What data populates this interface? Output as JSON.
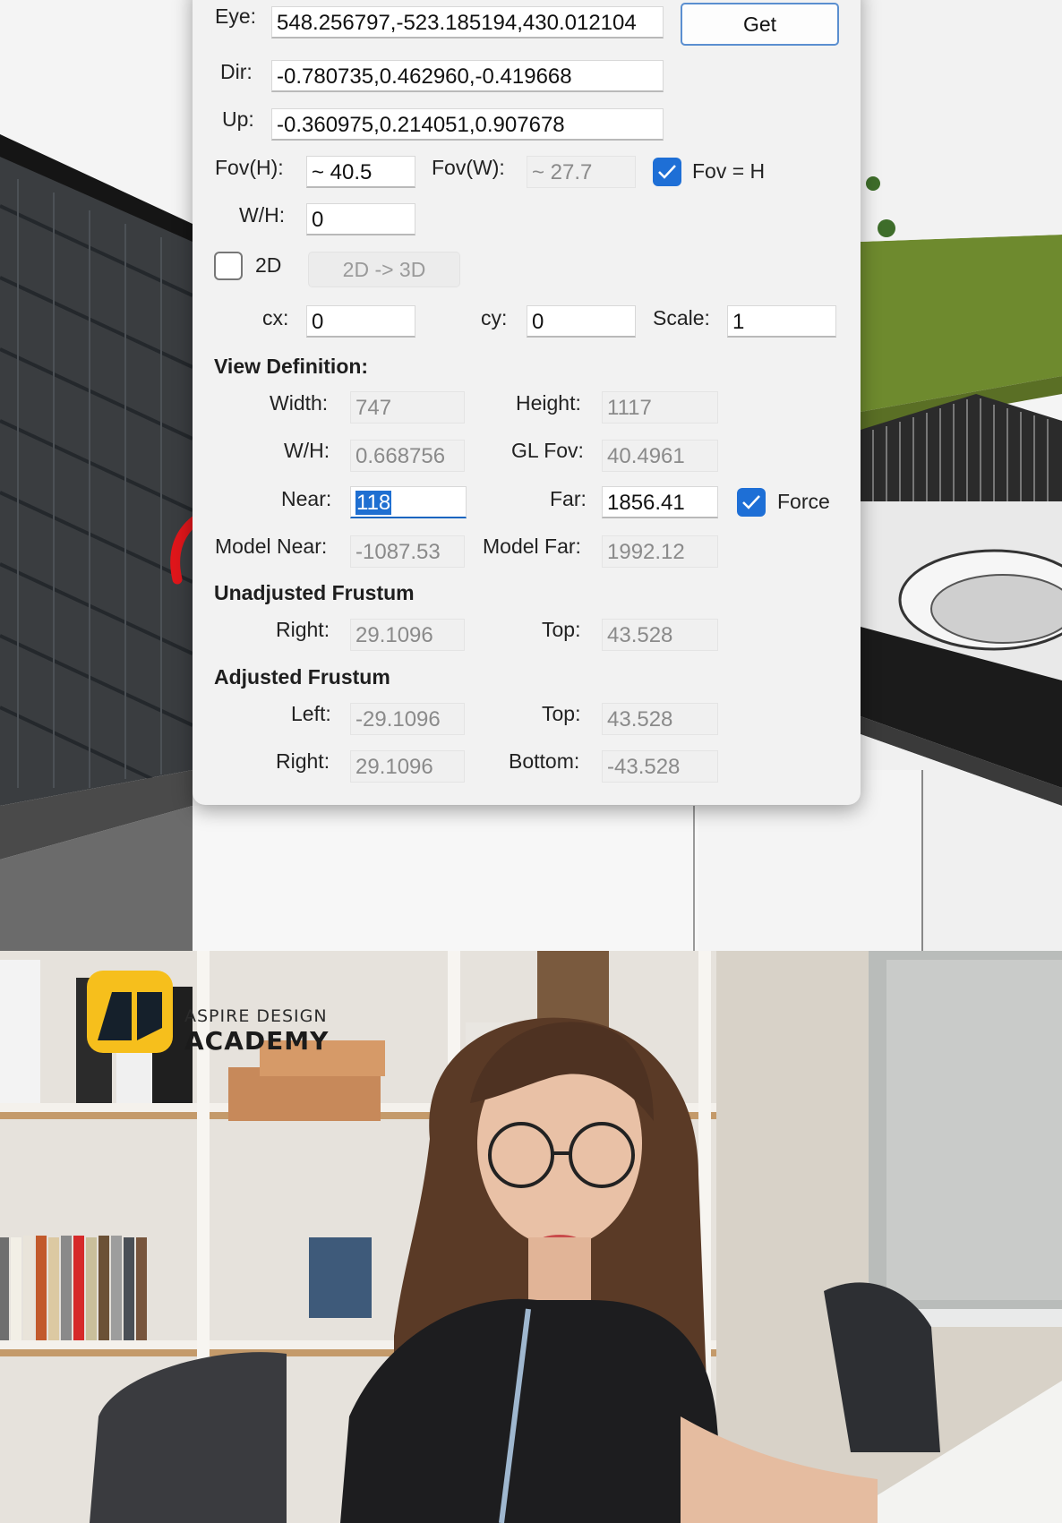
{
  "camera": {
    "eye_label": "Eye:",
    "eye_value": "548.256797,-523.185194,430.012104",
    "get_label": "Get",
    "dir_label": "Dir:",
    "dir_value": "-0.780735,0.462960,-0.419668",
    "up_label": "Up:",
    "up_value": "-0.360975,0.214051,0.907678",
    "fovh_label": "Fov(H):",
    "fovh_value": "~ 40.5",
    "fovw_label": "Fov(W):",
    "fovw_value": "~ 27.7",
    "fov_eq_h_label": "Fov = H",
    "fov_eq_h_checked": true,
    "wh_label": "W/H:",
    "wh_value": "0",
    "twod_label": "2D",
    "twod_checked": false,
    "twod_to_3d_label": "2D -> 3D",
    "cx_label": "cx:",
    "cx_value": "0",
    "cy_label": "cy:",
    "cy_value": "0",
    "scale_label": "Scale:",
    "scale_value": "1"
  },
  "view_definition": {
    "title": "View Definition:",
    "width_label": "Width:",
    "width_value": "747",
    "height_label": "Height:",
    "height_value": "1117",
    "wh_label": "W/H:",
    "wh_value": "0.668756",
    "glfov_label": "GL Fov:",
    "glfov_value": "40.4961",
    "near_label": "Near:",
    "near_value": "118",
    "far_label": "Far:",
    "far_value": "1856.41",
    "force_label": "Force",
    "force_checked": true,
    "model_near_label": "Model Near:",
    "model_near_value": "-1087.53",
    "model_far_label": "Model Far:",
    "model_far_value": "1992.12"
  },
  "unadjusted": {
    "title": "Unadjusted Frustum",
    "right_label": "Right:",
    "right_value": "29.1096",
    "top_label": "Top:",
    "top_value": "43.528"
  },
  "adjusted": {
    "title": "Adjusted Frustum",
    "left_label": "Left:",
    "left_value": "-29.1096",
    "top_label": "Top:",
    "top_value": "43.528",
    "right_label": "Right:",
    "right_value": "29.1096",
    "bottom_label": "Bottom:",
    "bottom_value": "-43.528"
  },
  "brand": {
    "line1": "ASPIRE DESIGN",
    "line2": "ACADEMY"
  },
  "colors": {
    "accent": "#1e6fd6",
    "arrow": "#e0161b",
    "logo": "#f6bf1c",
    "dialog_bg": "#f2f2f2"
  }
}
